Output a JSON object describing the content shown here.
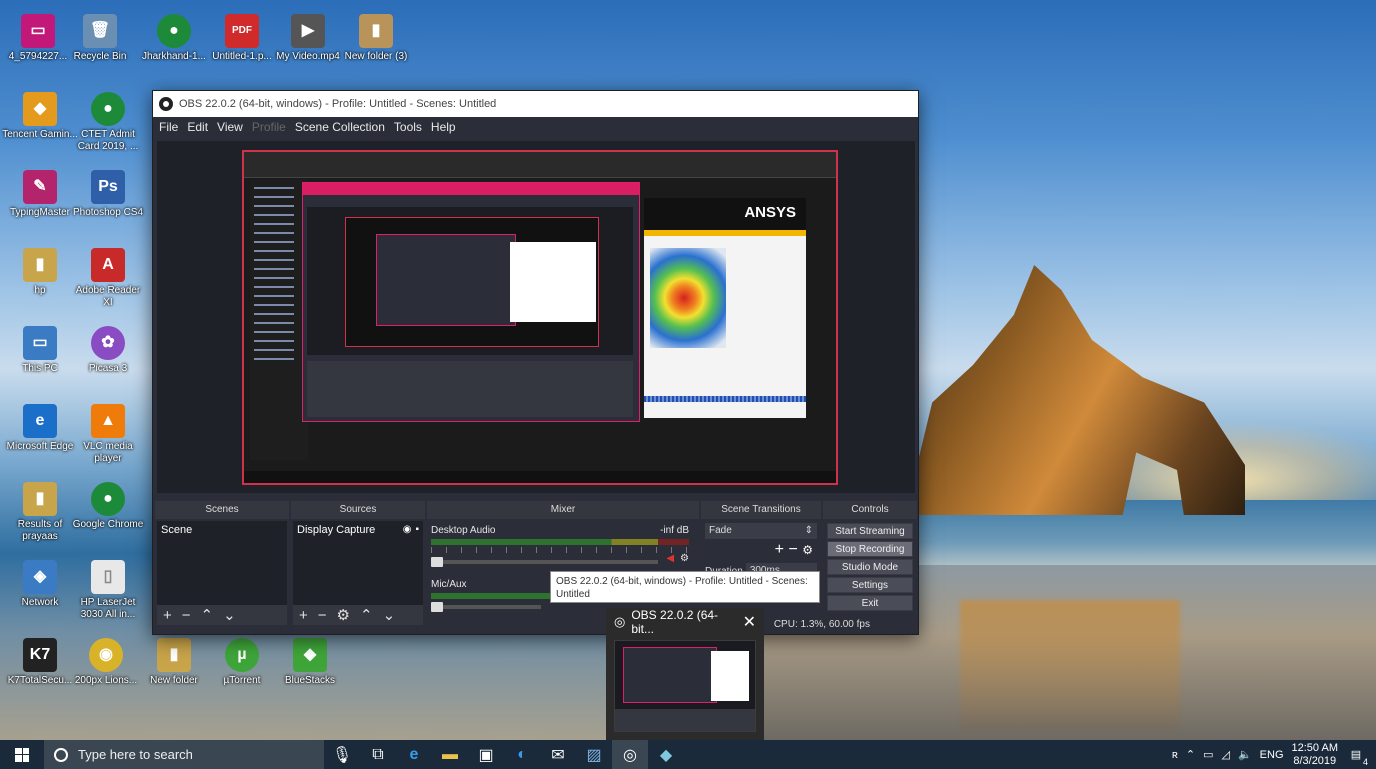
{
  "desktop": {
    "icons": [
      {
        "label": "4_5794227...",
        "glyph": "▭",
        "color": "#c2187a"
      },
      {
        "label": "Recycle Bin",
        "glyph": "🗑",
        "color": "#6b8fb3"
      },
      {
        "label": "Jharkhand-1...",
        "glyph": "●",
        "color": "#1d8a3a"
      },
      {
        "label": "Untitled-1.p...",
        "glyph": "PDF",
        "color": "#d02a2a"
      },
      {
        "label": "My Video.mp4",
        "glyph": "▶",
        "color": "#555"
      },
      {
        "label": "New folder (3)",
        "glyph": "▮",
        "color": "#b8935a"
      },
      {
        "label": "Tencent Gamin...",
        "glyph": "◆",
        "color": "#e39a1d"
      },
      {
        "label": "CTET Admit Card 2019, ...",
        "glyph": "●",
        "color": "#1d8a3a"
      },
      {
        "label": "TypingMaster",
        "glyph": "✎",
        "color": "#b3246c"
      },
      {
        "label": "Photoshop CS4",
        "glyph": "Ps",
        "color": "#2e5fa8"
      },
      {
        "label": "hp",
        "glyph": "▮",
        "color": "#c8a44a"
      },
      {
        "label": "Adobe Reader XI",
        "glyph": "A",
        "color": "#c82a2a"
      },
      {
        "label": "This PC",
        "glyph": "▭",
        "color": "#3b7bc4"
      },
      {
        "label": "Picasa 3",
        "glyph": "✿",
        "color": "#8a4cc2"
      },
      {
        "label": "Microsoft Edge",
        "glyph": "e",
        "color": "#1b6fc8"
      },
      {
        "label": "VLC media player",
        "glyph": "▲",
        "color": "#ef7c0a"
      },
      {
        "label": "Results of prayaas",
        "glyph": "▮",
        "color": "#c8a44a"
      },
      {
        "label": "Google Chrome",
        "glyph": "●",
        "color": "#1d8a3a"
      },
      {
        "label": "Network",
        "glyph": "◈",
        "color": "#3b7bc4"
      },
      {
        "label": "HP LaserJet 3030 All in...",
        "glyph": "▯",
        "color": "#e8e8e8"
      },
      {
        "label": "K7TotalSecu...",
        "glyph": "K7",
        "color": "#222"
      },
      {
        "label": "200px Lions...",
        "glyph": "◉",
        "color": "#d8b32a"
      },
      {
        "label": "New folder",
        "glyph": "▮",
        "color": "#c8a44a"
      },
      {
        "label": "µTorrent",
        "glyph": "µ",
        "color": "#3ea53a"
      },
      {
        "label": "BlueStacks",
        "glyph": "◆",
        "color": "#3fa53a"
      }
    ]
  },
  "obs": {
    "title": "OBS 22.0.2 (64-bit, windows) - Profile: Untitled - Scenes: Untitled",
    "menu": [
      "File",
      "Edit",
      "View",
      "Profile",
      "Scene Collection",
      "Tools",
      "Help"
    ],
    "capture": {
      "ansys_logo": "ANSYS"
    },
    "scenes": {
      "header": "Scenes",
      "items": [
        "Scene"
      ]
    },
    "sources": {
      "header": "Sources",
      "items": [
        "Display Capture"
      ]
    },
    "mixer": {
      "header": "Mixer",
      "channels": [
        {
          "name": "Desktop Audio",
          "level": "-inf dB"
        },
        {
          "name": "Mic/Aux",
          "level": ""
        }
      ]
    },
    "transitions": {
      "header": "Scene Transitions",
      "selected": "Fade",
      "duration_label": "Duration",
      "duration_value": "300ms"
    },
    "controls": {
      "header": "Controls",
      "buttons": [
        "Start Streaming",
        "Stop Recording",
        "Studio Mode",
        "Settings",
        "Exit"
      ]
    },
    "status": "CPU: 1.3%, 60.00 fps"
  },
  "tooltip": {
    "text": "OBS 22.0.2 (64-bit, windows) - Profile: Untitled - Scenes: Untitled"
  },
  "thumbnail": {
    "title": "OBS 22.0.2 (64-bit..."
  },
  "taskbar": {
    "search_placeholder": "Type here to search",
    "language": "ENG",
    "time": "12:50 AM",
    "date": "8/3/2019",
    "notification_count": "4"
  }
}
